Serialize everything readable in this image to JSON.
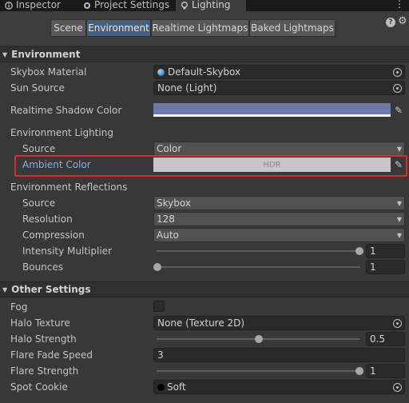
{
  "window_tabs": {
    "inspector": "Inspector",
    "project_settings": "Project Settings",
    "lighting": "Lighting"
  },
  "toolbar": {
    "scene": "Scene",
    "environment": "Environment",
    "realtime": "Realtime Lightmaps",
    "baked": "Baked Lightmaps",
    "help": "?"
  },
  "environment": {
    "header": "Environment",
    "skybox_material": {
      "label": "Skybox Material",
      "value": "Default-Skybox"
    },
    "sun_source": {
      "label": "Sun Source",
      "value": "None (Light)"
    },
    "realtime_shadow_color": {
      "label": "Realtime Shadow Color",
      "color": "#6b7aaa"
    },
    "env_lighting": {
      "label": "Environment Lighting"
    },
    "lighting_source": {
      "label": "Source",
      "value": "Color"
    },
    "ambient_color": {
      "label": "Ambient Color",
      "value": "HDR",
      "color": "#c6c6c6"
    },
    "env_reflections": {
      "label": "Environment Reflections"
    },
    "reflection_source": {
      "label": "Source",
      "value": "Skybox"
    },
    "resolution": {
      "label": "Resolution",
      "value": "128"
    },
    "compression": {
      "label": "Compression",
      "value": "Auto"
    },
    "intensity": {
      "label": "Intensity Multiplier",
      "value": "1",
      "fraction": 1.0
    },
    "bounces": {
      "label": "Bounces",
      "value": "1",
      "fraction": 0.0
    }
  },
  "other": {
    "header": "Other Settings",
    "fog": {
      "label": "Fog",
      "checked": false
    },
    "halo_texture": {
      "label": "Halo Texture",
      "value": "None (Texture 2D)"
    },
    "halo_strength": {
      "label": "Halo Strength",
      "value": "0.5",
      "fraction": 0.5
    },
    "flare_fade": {
      "label": "Flare Fade Speed",
      "value": "3"
    },
    "flare_strength": {
      "label": "Flare Strength",
      "value": "1",
      "fraction": 1.0
    },
    "spot_cookie": {
      "label": "Spot Cookie",
      "value": "Soft"
    }
  },
  "highlight_color": "#d32f2f"
}
